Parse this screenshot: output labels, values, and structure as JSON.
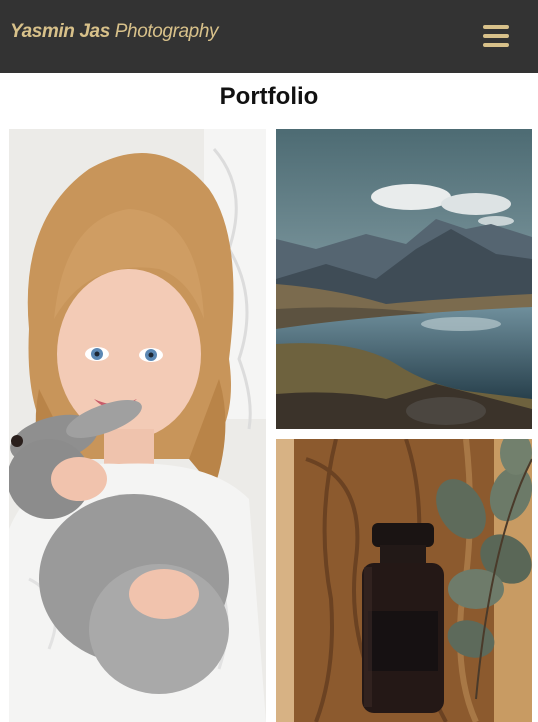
{
  "navbar": {
    "brand_bold": "Yasmin Jas",
    "brand_rest": " Photography",
    "menu_icon": "hamburger-menu-icon",
    "background": "#333333",
    "accent": "#d8c18a"
  },
  "main": {
    "title": "Portfolio"
  }
}
